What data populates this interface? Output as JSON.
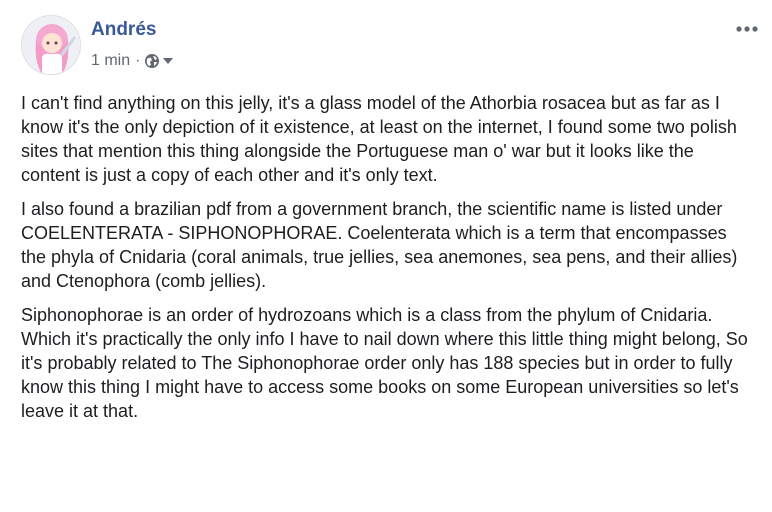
{
  "post": {
    "author": "Andrés",
    "time": "1 min",
    "separator": "·",
    "audience_icon": "globe-icon",
    "more_icon": "ellipsis-icon",
    "paragraphs": [
      "I can't find anything on this jelly, it's a glass model of the Athorbia rosacea but as far as I know it's the only depiction of it existence, at least on the internet, I found some two polish sites that mention this thing alongside the Portuguese man o' war but it looks like the content is just a copy of each other and it's only text.",
      "I also found a brazilian pdf from a government branch, the scientific name is listed under COELENTERATA - SIPHONOPHORAE. Coelenterata which is a term that encompasses the phyla of Cnidaria (coral animals, true jellies, sea anemones, sea pens, and their allies) and Ctenophora (comb jellies).",
      "Siphonophorae is an order of hydrozoans which is a class from the phylum of Cnidaria. Which it's practically the only info I have to nail down where this little thing might belong, So it's probably related to The Siphonophorae order only has 188 species but in order to fully know this thing I might have to access some books on some European universities so let's leave it at that."
    ]
  },
  "colors": {
    "author": "#385898",
    "meta": "#616770",
    "text": "#1c1e21"
  }
}
